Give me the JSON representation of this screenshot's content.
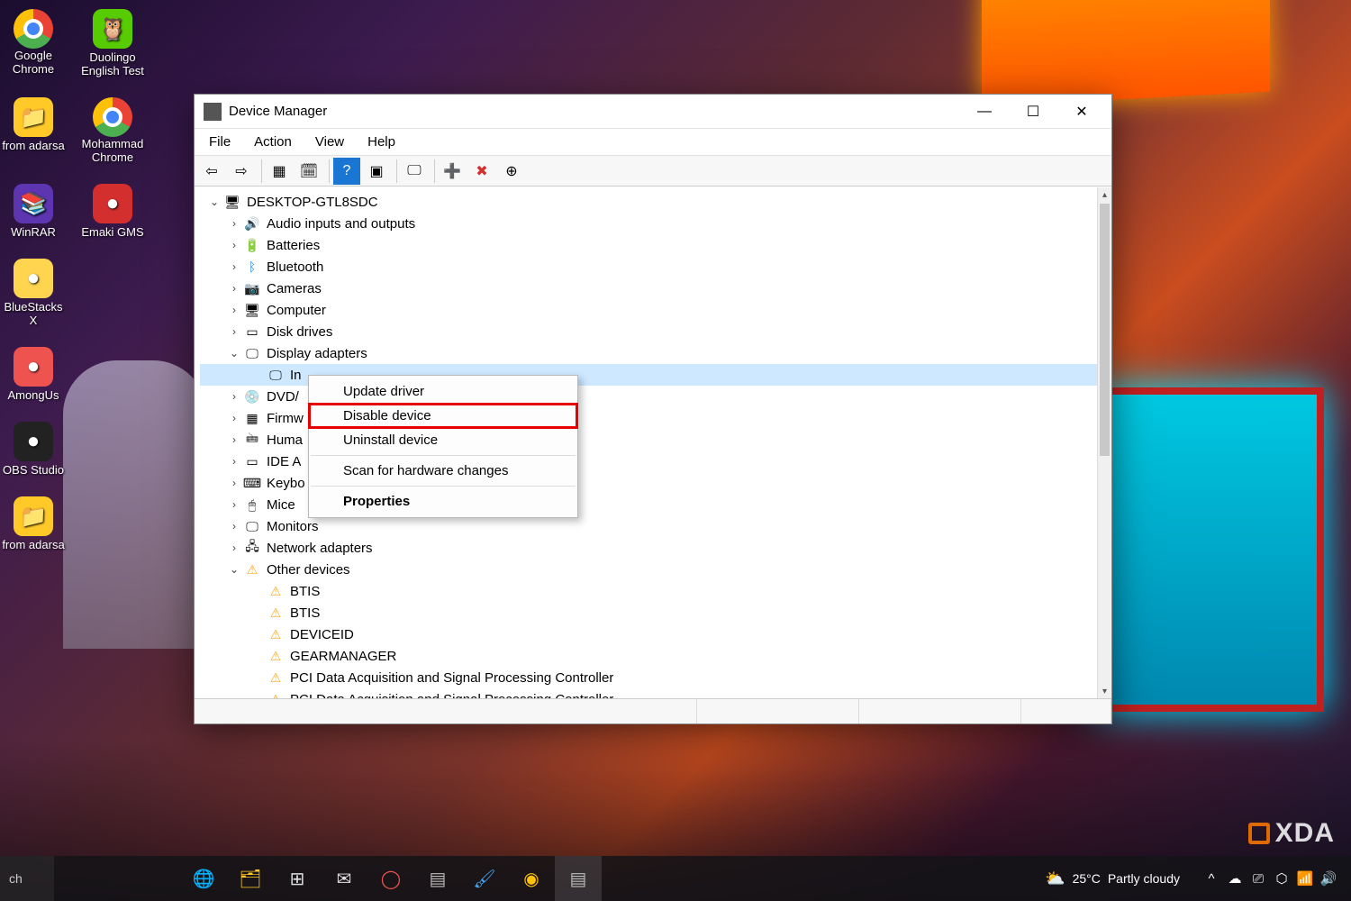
{
  "window": {
    "title": "Device Manager",
    "controls": {
      "minimize": "—",
      "maximize": "☐",
      "close": "✕"
    }
  },
  "menubar": [
    "File",
    "Action",
    "View",
    "Help"
  ],
  "toolbar_buttons": [
    {
      "name": "back",
      "glyph": "⇦"
    },
    {
      "name": "forward",
      "glyph": "⇨"
    },
    {
      "sep": true
    },
    {
      "name": "show-hidden",
      "glyph": "▦"
    },
    {
      "name": "refresh",
      "glyph": "🗓"
    },
    {
      "sep": true
    },
    {
      "name": "help",
      "glyph": "?",
      "bg": "#1976d2",
      "fg": "#fff"
    },
    {
      "name": "scan",
      "glyph": "▣"
    },
    {
      "sep": true
    },
    {
      "name": "monitor",
      "glyph": "🖵"
    },
    {
      "sep": true
    },
    {
      "name": "enable",
      "glyph": "➕",
      "fg": "#2e7d32"
    },
    {
      "name": "disable",
      "glyph": "✖",
      "fg": "#d32f2f"
    },
    {
      "name": "update-arrow",
      "glyph": "⊕"
    }
  ],
  "tree": {
    "root": {
      "label": "DESKTOP-GTL8SDC",
      "icon": "🖥",
      "expanded": true
    },
    "children": [
      {
        "label": "Audio inputs and outputs",
        "icon": "🔊",
        "chev": ">"
      },
      {
        "label": "Batteries",
        "icon": "🔋",
        "chev": ">"
      },
      {
        "label": "Bluetooth",
        "icon": "ᛒ",
        "iconColor": "#1e88e5",
        "chev": ">"
      },
      {
        "label": "Cameras",
        "icon": "📷",
        "chev": ">"
      },
      {
        "label": "Computer",
        "icon": "🖥",
        "chev": ">"
      },
      {
        "label": "Disk drives",
        "icon": "▭",
        "chev": ">"
      },
      {
        "label": "Display adapters",
        "icon": "🖵",
        "chev": "v",
        "expanded": true,
        "children": [
          {
            "label": "In",
            "icon": "🖵",
            "selected": true
          }
        ]
      },
      {
        "label": "DVD/",
        "icon": "💿",
        "chev": ">"
      },
      {
        "label": "Firmw",
        "icon": "▦",
        "chev": ">"
      },
      {
        "label": "Huma",
        "icon": "🖮",
        "chev": ">"
      },
      {
        "label": "IDE A",
        "icon": "▭",
        "chev": ">"
      },
      {
        "label": "Keybo",
        "icon": "⌨",
        "chev": ">"
      },
      {
        "label": "Mice ",
        "icon": "🖱",
        "chev": ">"
      },
      {
        "label": "Monitors",
        "icon": "🖵",
        "chev": ">"
      },
      {
        "label": "Network adapters",
        "icon": "🖧",
        "chev": ">"
      },
      {
        "label": "Other devices",
        "icon": "⚠",
        "iconColor": "#f9a825",
        "chev": "v",
        "expanded": true,
        "children": [
          {
            "label": "BTIS",
            "icon": "⚠",
            "iconColor": "#f9a825"
          },
          {
            "label": "BTIS",
            "icon": "⚠",
            "iconColor": "#f9a825"
          },
          {
            "label": "DEVICEID",
            "icon": "⚠",
            "iconColor": "#f9a825"
          },
          {
            "label": "GEARMANAGER",
            "icon": "⚠",
            "iconColor": "#f9a825"
          },
          {
            "label": "PCI Data Acquisition and Signal Processing Controller",
            "icon": "⚠",
            "iconColor": "#f9a825"
          },
          {
            "label": "PCI Data Acquisition and Signal Processing Controller",
            "icon": "⚠",
            "iconColor": "#f9a825"
          }
        ]
      }
    ]
  },
  "contextmenu": [
    {
      "label": "Update driver"
    },
    {
      "label": "Disable device",
      "highlighted": true
    },
    {
      "label": "Uninstall device"
    },
    {
      "sep": true
    },
    {
      "label": "Scan for hardware changes"
    },
    {
      "sep": true
    },
    {
      "label": "Properties",
      "bold": true
    }
  ],
  "desktop_icons": [
    [
      {
        "label": "Google Chrome",
        "kind": "chrome"
      },
      {
        "label": "Duolingo English Test",
        "kind": "duolingo",
        "bg": "#58cc02"
      }
    ],
    [
      {
        "label": "from adarsa",
        "kind": "folder",
        "bg": "#ffca28"
      },
      {
        "label": "Mohammad Chrome",
        "kind": "chrome"
      }
    ],
    [
      {
        "label": "WinRAR",
        "kind": "winrar",
        "bg": "#5e35b1"
      },
      {
        "label": "Emaki GMS",
        "kind": "app",
        "bg": "#d32f2f"
      }
    ],
    [
      {
        "label": "BlueStacks X",
        "kind": "app",
        "bg": "#ffd54f"
      },
      {
        "label": "",
        "kind": "none"
      }
    ],
    [
      {
        "label": "AmongUs",
        "kind": "app",
        "bg": "#ef5350"
      },
      {
        "label": "",
        "kind": "none"
      }
    ],
    [
      {
        "label": "OBS Studio",
        "kind": "app",
        "bg": "#222"
      },
      {
        "label": "",
        "kind": "none"
      }
    ],
    [
      {
        "label": "from adarsa",
        "kind": "folder",
        "bg": "#ffca28"
      },
      {
        "label": "",
        "kind": "none"
      }
    ]
  ],
  "taskbar": {
    "search_text": "ch",
    "pinned": [
      {
        "name": "edge",
        "glyph": "🌐",
        "color": "#29b6f6"
      },
      {
        "name": "explorer",
        "glyph": "🗂",
        "color": "#ffca28"
      },
      {
        "name": "store",
        "glyph": "⊞",
        "color": "#e0e0e0"
      },
      {
        "name": "mail",
        "glyph": "✉",
        "color": "#e0e0e0"
      },
      {
        "name": "opera",
        "glyph": "◯",
        "color": "#ef5350"
      },
      {
        "name": "devmgr",
        "glyph": "▤",
        "color": "#bbb"
      },
      {
        "name": "paint",
        "glyph": "🖌",
        "color": "#42a5f5"
      },
      {
        "name": "chrome",
        "glyph": "◉",
        "color": "#ffc107"
      },
      {
        "name": "devmgr2",
        "glyph": "▤",
        "color": "#bbb",
        "active": true
      }
    ],
    "weather": {
      "temp": "25°C",
      "text": "Partly cloudy",
      "icon": "⛅"
    },
    "tray": [
      "^",
      "☁",
      "⎚",
      "⬡",
      "📶",
      "🔊"
    ]
  },
  "watermark": "XDA"
}
